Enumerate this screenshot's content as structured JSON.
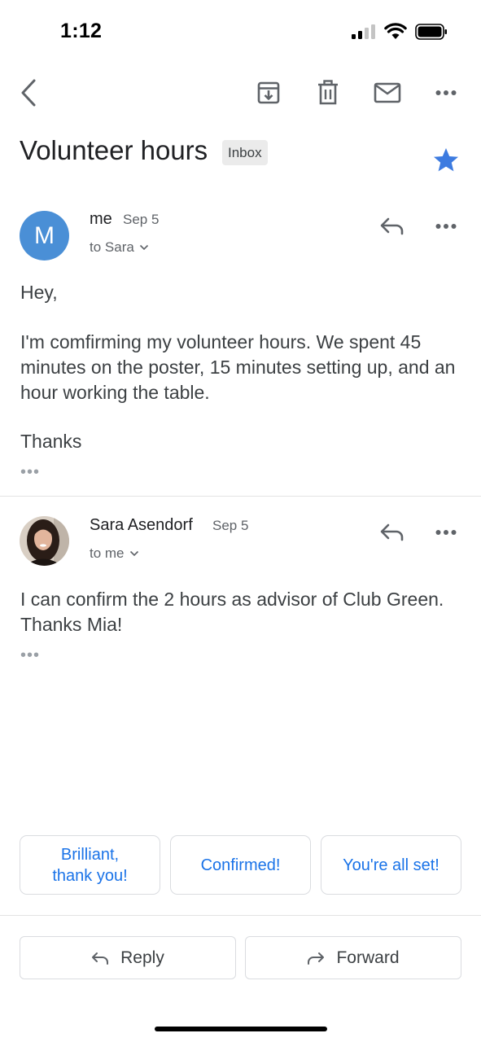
{
  "status_bar": {
    "time": "1:12"
  },
  "toolbar": {
    "icons": [
      "back-icon",
      "archive-icon",
      "delete-icon",
      "mark-unread-icon",
      "more-icon"
    ]
  },
  "subject": {
    "title": "Volunteer hours",
    "label": "Inbox",
    "starred": true
  },
  "messages": [
    {
      "avatar_letter": "M",
      "sender": "me",
      "date": "Sep 5",
      "to": "to Sara",
      "body": [
        "Hey,",
        "I'm comfirming my volunteer hours. We spent 45 minutes on the poster, 15 minutes setting up, and an hour working the table.",
        "Thanks"
      ],
      "trimmed": "•••"
    },
    {
      "sender": "Sara Asendorf",
      "date": "Sep 5",
      "to": "to me",
      "body": [
        "I can confirm the 2 hours as advisor of Club Green. Thanks Mia!"
      ],
      "trimmed": "•••"
    }
  ],
  "smart_replies": [
    "Brilliant, thank you!",
    "Confirmed!",
    "You're all set!"
  ],
  "actions": {
    "reply": "Reply",
    "forward": "Forward"
  },
  "colors": {
    "accent": "#1a73e8",
    "avatar": "#4a8fd6",
    "star": "#3d7be0"
  }
}
